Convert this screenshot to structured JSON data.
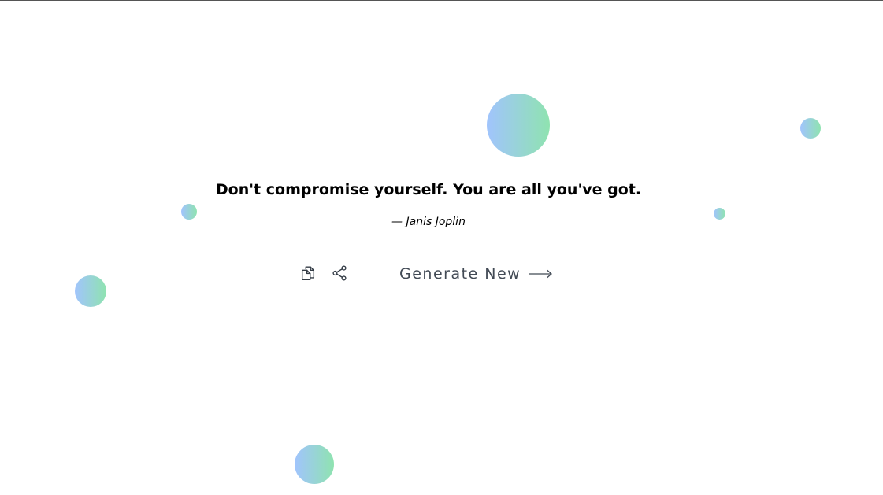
{
  "quote": {
    "text": "Don't compromise yourself. You are all you've got.",
    "author": "— Janis Joplin"
  },
  "actions": {
    "copy_icon": "copy-icon",
    "share_icon": "share-icon",
    "generate_label": "Generate New",
    "generate_icon": "arrow-right-icon"
  },
  "theme": {
    "bubble_gradient_start": "#a1c4fd",
    "bubble_gradient_end": "#8fe3b0",
    "text_color": "#000000",
    "action_color": "#424a55"
  }
}
